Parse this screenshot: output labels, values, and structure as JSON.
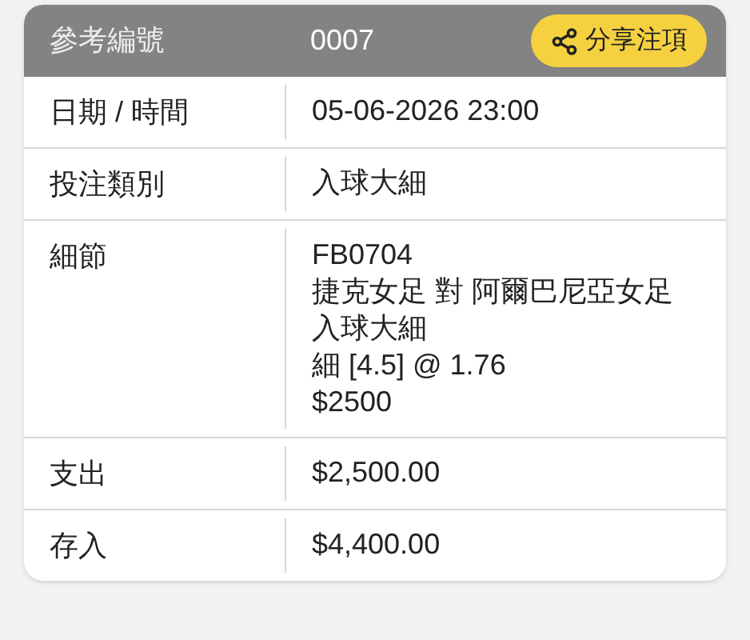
{
  "header": {
    "label": "參考編號",
    "value": "0007",
    "share_button": "分享注項"
  },
  "rows": [
    {
      "label": "日期 / 時間",
      "lines": [
        "05-06-2026 23:00"
      ]
    },
    {
      "label": "投注類別",
      "lines": [
        "入球大細"
      ]
    },
    {
      "label": "細節",
      "lines": [
        "FB0704",
        "捷克女足 對 阿爾巴尼亞女足",
        "入球大細",
        "細 [4.5] @ 1.76",
        "$2500"
      ]
    },
    {
      "label": "支出",
      "lines": [
        "$2,500.00"
      ]
    },
    {
      "label": "存入",
      "lines": [
        "$4,400.00"
      ]
    }
  ]
}
